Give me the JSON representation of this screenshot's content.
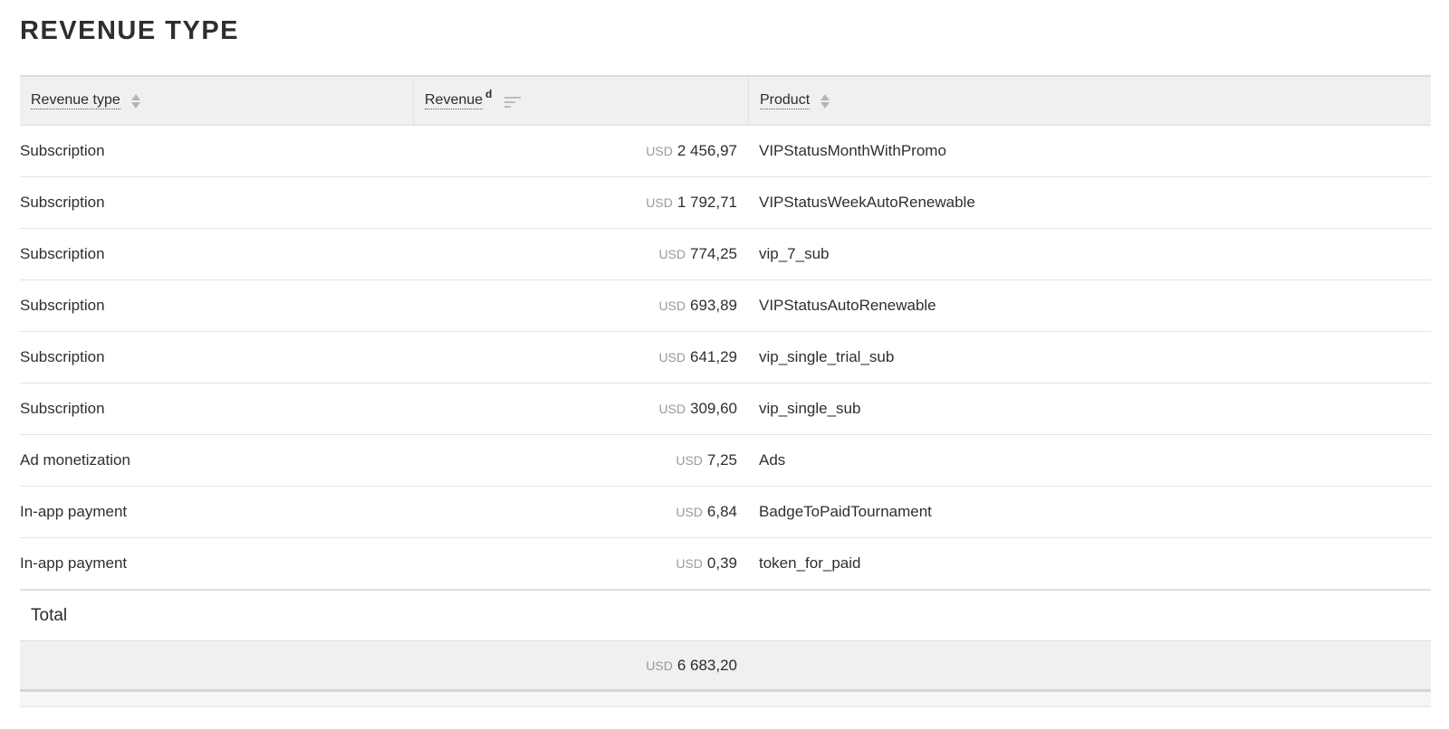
{
  "title": "REVENUE TYPE",
  "columns": {
    "revenue_type": "Revenue type",
    "revenue": "Revenue",
    "revenue_superscript": "d",
    "product": "Product"
  },
  "rows": [
    {
      "type": "Subscription",
      "currency": "USD",
      "amount": "2 456,97",
      "product": "VIPStatusMonthWithPromo"
    },
    {
      "type": "Subscription",
      "currency": "USD",
      "amount": "1 792,71",
      "product": "VIPStatusWeekAutoRenewable"
    },
    {
      "type": "Subscription",
      "currency": "USD",
      "amount": "774,25",
      "product": "vip_7_sub"
    },
    {
      "type": "Subscription",
      "currency": "USD",
      "amount": "693,89",
      "product": "VIPStatusAutoRenewable"
    },
    {
      "type": "Subscription",
      "currency": "USD",
      "amount": "641,29",
      "product": "vip_single_trial_sub"
    },
    {
      "type": "Subscription",
      "currency": "USD",
      "amount": "309,60",
      "product": "vip_single_sub"
    },
    {
      "type": "Ad monetization",
      "currency": "USD",
      "amount": "7,25",
      "product": "Ads"
    },
    {
      "type": "In-app payment",
      "currency": "USD",
      "amount": "6,84",
      "product": "BadgeToPaidTournament"
    },
    {
      "type": "In-app payment",
      "currency": "USD",
      "amount": "0,39",
      "product": "token_for_paid"
    }
  ],
  "total": {
    "label": "Total",
    "currency": "USD",
    "amount": "6 683,20"
  },
  "icons": {
    "revenue_type_sort": "sort-arrows-icon",
    "revenue_sort": "sort-descending-icon",
    "product_sort": "sort-arrows-icon"
  }
}
